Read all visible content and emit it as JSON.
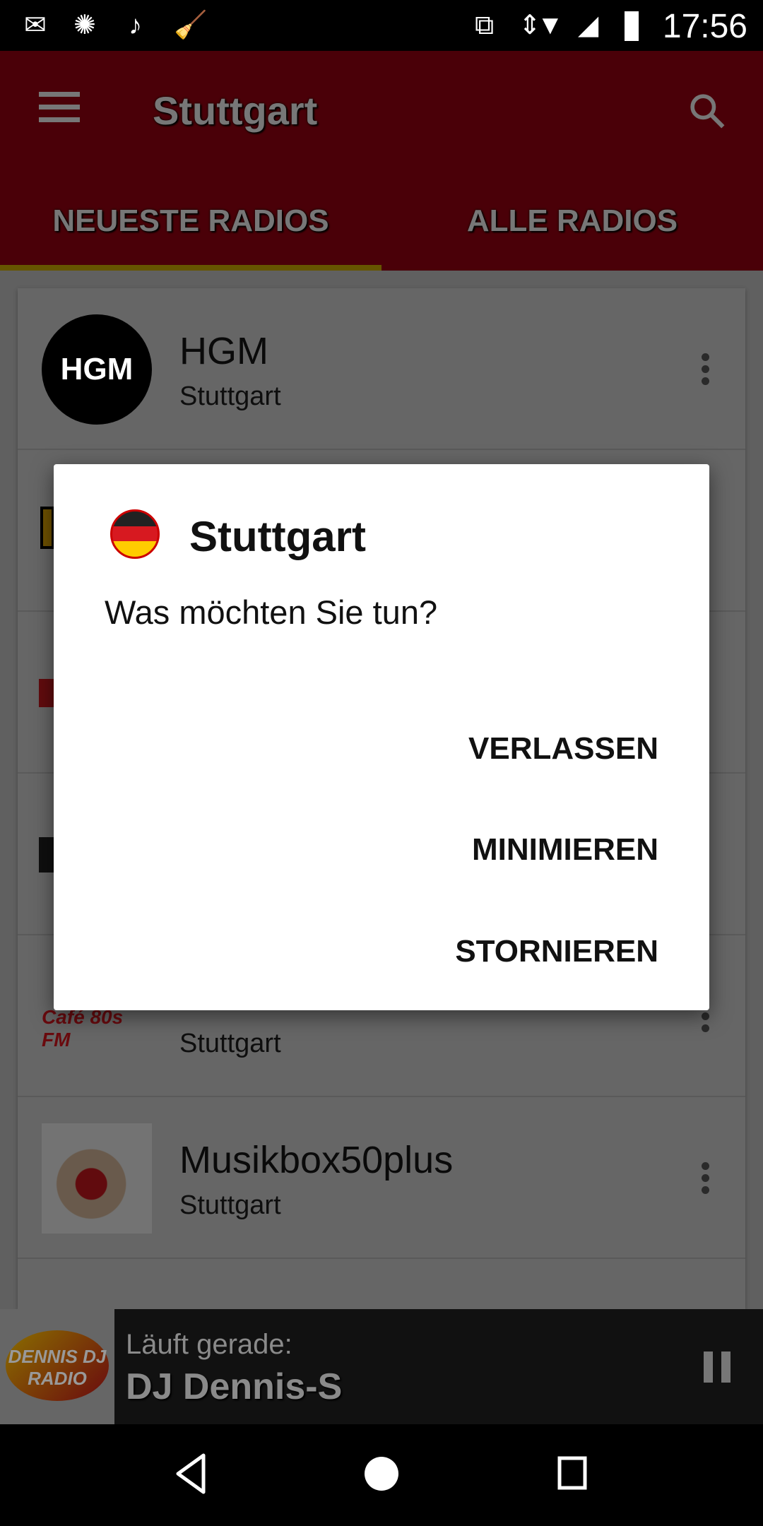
{
  "status_bar": {
    "time": "17:56",
    "icons": [
      "mail-icon",
      "aperture-icon",
      "music-note-icon",
      "broom-icon",
      "cast-icon",
      "data-arrows-icon",
      "wifi-icon",
      "signal-icon",
      "battery-icon"
    ]
  },
  "toolbar": {
    "title": "Stuttgart",
    "menu_icon": "hamburger-menu-icon",
    "search_icon": "search-icon"
  },
  "tabs": [
    {
      "label": "NEUESTE RADIOS",
      "active": true
    },
    {
      "label": "ALLE RADIOS",
      "active": false
    }
  ],
  "stations": [
    {
      "name": "HGM",
      "city": "Stuttgart"
    },
    {
      "name": "",
      "city": ""
    },
    {
      "name": "",
      "city": ""
    },
    {
      "name": "",
      "city": ""
    },
    {
      "name": "",
      "city": "Stuttgart",
      "logo_text": "Café 80s FM"
    },
    {
      "name": "Musikbox50plus",
      "city": "Stuttgart"
    },
    {
      "name": "",
      "city": ""
    }
  ],
  "player": {
    "label": "Läuft gerade:",
    "station": "DJ Dennis-S",
    "logo_text": "DENNIS DJ RADIO"
  },
  "dialog": {
    "title": "Stuttgart",
    "message": "Was möchten Sie tun?",
    "buttons": [
      "VERLASSEN",
      "MINIMIEREN",
      "STORNIEREN"
    ]
  },
  "colors": {
    "primary": "#b80014",
    "tab_indicator": "#ffd600",
    "scrim": "rgba(0,0,0,0.6)"
  }
}
